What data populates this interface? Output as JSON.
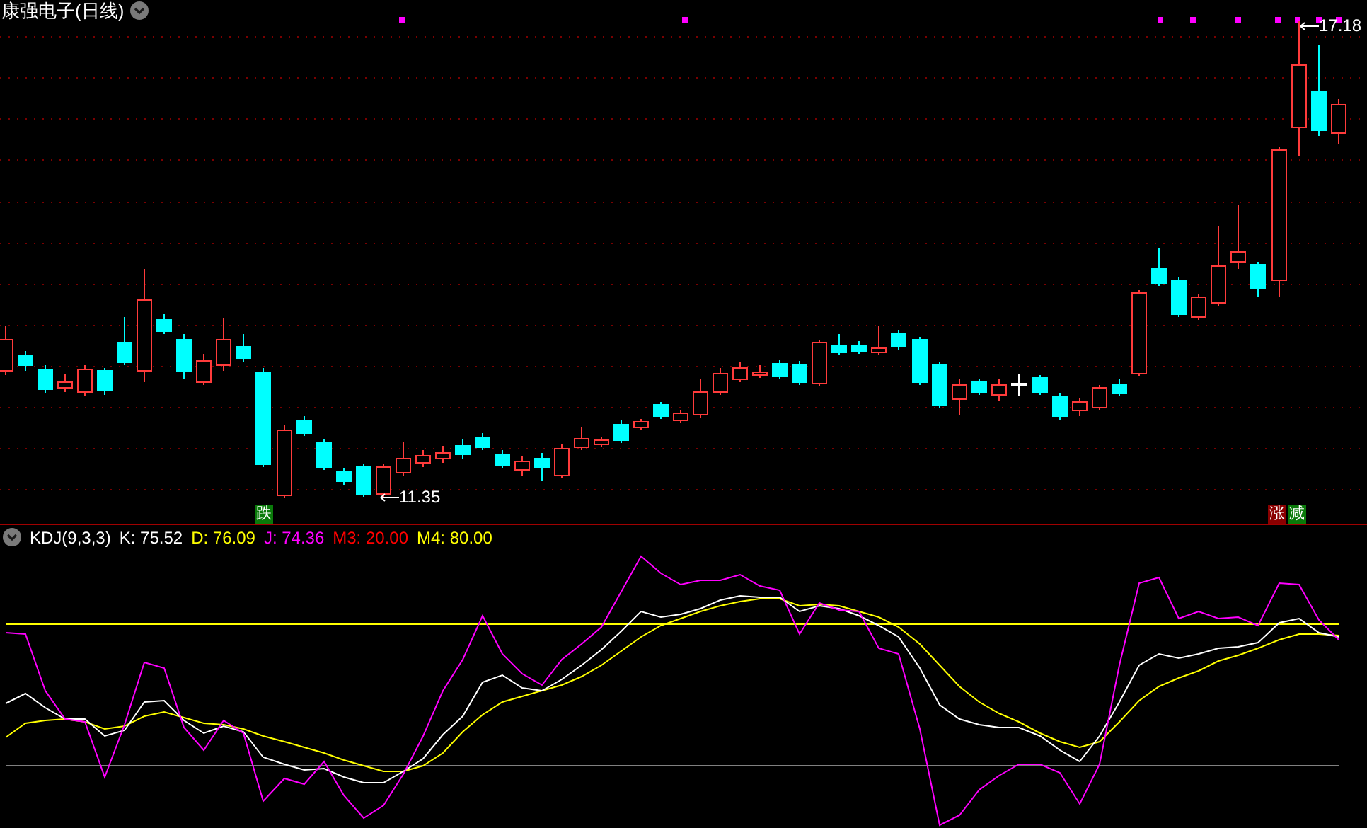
{
  "chart_header": {
    "title": "康强电子(日线)"
  },
  "price_labels": [
    {
      "kind": "high",
      "text": "17.18"
    },
    {
      "kind": "low",
      "text": "11.35"
    }
  ],
  "signal_badges": [
    {
      "text": "跌",
      "color": "#0a7a0a"
    },
    {
      "text": "涨",
      "color": "#8a0000"
    },
    {
      "text": "减",
      "color": "#0a7a0a"
    }
  ],
  "indicator": {
    "name": "KDJ(9,3,3)",
    "values": [
      {
        "text": "K: 75.52",
        "color": "#ffffff"
      },
      {
        "text": "D: 76.09",
        "color": "#ffff00"
      },
      {
        "text": "J: 74.36",
        "color": "#ff00ff"
      },
      {
        "text": "M3: 20.00",
        "color": "#ff0000"
      },
      {
        "text": "M4: 80.00",
        "color": "#ffff00"
      }
    ]
  }
}
